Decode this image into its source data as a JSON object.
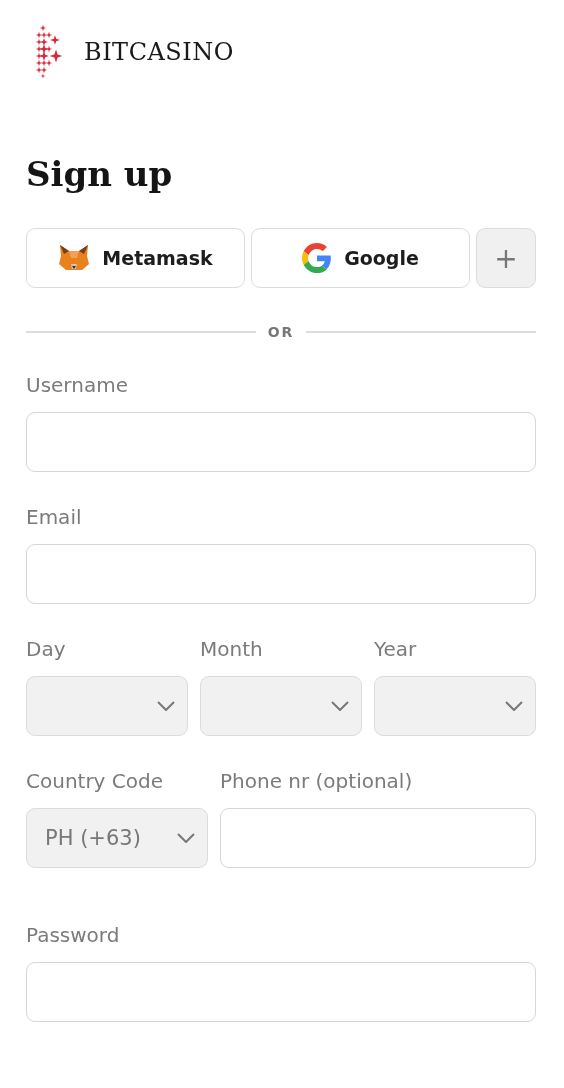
{
  "brand": {
    "name": "BITCASINO"
  },
  "heading": "Sign up",
  "social_buttons": [
    {
      "kind": "metamask",
      "label": "Metamask"
    },
    {
      "kind": "google",
      "label": "Google"
    },
    {
      "kind": "more",
      "label": "+"
    }
  ],
  "divider": "OR",
  "rows": [
    [
      {
        "kind": "text",
        "label": "Username"
      }
    ],
    [
      {
        "kind": "text",
        "label": "Email"
      }
    ],
    [
      {
        "kind": "select",
        "label": "Day"
      },
      {
        "kind": "select",
        "label": "Month"
      },
      {
        "kind": "select",
        "label": "Year"
      }
    ],
    [
      {
        "kind": "select",
        "label": "Country Code",
        "value": "PH (+63)"
      },
      {
        "kind": "text",
        "label": "Phone nr (optional)"
      }
    ],
    [
      {
        "kind": "password",
        "label": "Password"
      }
    ]
  ]
}
